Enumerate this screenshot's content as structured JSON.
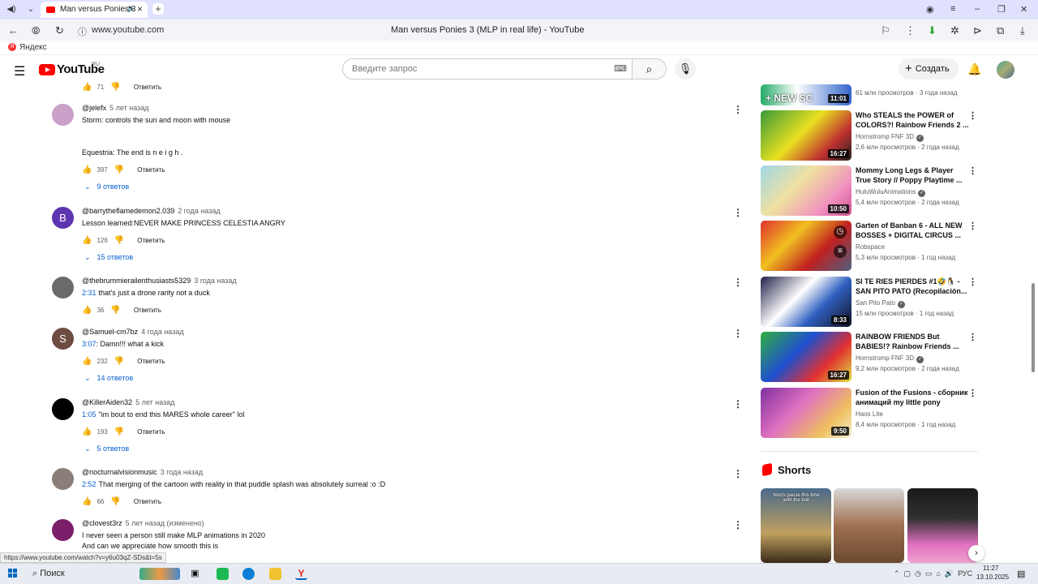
{
  "browser": {
    "tab_title": "Man versus Ponies 3",
    "url": "www.youtube.com",
    "page_title": "Man versus Ponies 3 (MLP in real life) - YouTube",
    "bookmark": "Яндекс",
    "status_url": "https://www.youtube.com/watch?v=y6u03qZ-SDs&t=5s"
  },
  "header": {
    "logo": "YouTube",
    "region": "RU",
    "search_placeholder": "Введите запрос",
    "create_label": "Создать"
  },
  "top_partial": {
    "likes": "71",
    "reply": "Ответить"
  },
  "comments": [
    {
      "author": "@jelefx",
      "time": "5 лет назад",
      "line1": "Storm: controls the sun and moon with mouse",
      "line2": "Equestria: The end is n e i g h .",
      "likes": "397",
      "reply": "Ответить",
      "replies": "9 ответов"
    },
    {
      "author": "@barrytheflamedemon2.039",
      "time": "2 года назад",
      "initial": "B",
      "text": "Lesson learned:NEVER MAKE PRINCESS CELESTIA ANGRY",
      "likes": "126",
      "reply": "Ответить",
      "replies": "15 ответов"
    },
    {
      "author": "@thebrummierailenthusiasts5329",
      "time": "3 года назад",
      "ts": "2:31",
      "text": "that's just a drone rarity not a duck",
      "likes": "36",
      "reply": "Ответить"
    },
    {
      "author": "@Samuel-cm7bz",
      "time": "4 года назад",
      "initial": "S",
      "ts": "3:07",
      "text": ": Damn!!! what a kick",
      "likes": "232",
      "reply": "Ответить",
      "replies": "14 ответов"
    },
    {
      "author": "@KillerAiden32",
      "time": "5 лет назад",
      "ts": "1:05",
      "text": "\"im bout to end this MARES whole career\" lol",
      "likes": "193",
      "reply": "Ответить",
      "replies": "5 ответов"
    },
    {
      "author": "@nocturnalvisionmusic",
      "time": "3 года назад",
      "ts": "2:52",
      "text": "That merging of the cartoon with reality in that puddle splash was absolutely surreal :o :D",
      "likes": "66",
      "reply": "Ответить"
    },
    {
      "author": "@clovest3rz",
      "time": "5 лет назад (изменено)",
      "line1": "I never seen a person still make MLP animations in 2020",
      "line2": "And can we appreciate how smooth this is"
    }
  ],
  "sidebar": {
    "partial": {
      "duration": "11:01",
      "thumb_text": "+ NEW SC",
      "meta": "61 млн просмотров · 3 года назад"
    },
    "videos": [
      {
        "title": "Who STEALS the POWER of COLORS?! Rainbow Friends 2 ...",
        "channel": "Hornstromp FNF 3D",
        "meta": "2,6 млн просмотров · 2 года назад",
        "duration": "16:27"
      },
      {
        "title": "Mommy Long Legs & Player True Story // Poppy Playtime ...",
        "channel": "HuluWuluAnimations",
        "meta": "5,4 млн просмотров · 2 года назад",
        "duration": "10:50"
      },
      {
        "title": "Garten of Banban 6 - ALL NEW BOSSES + DIGITAL CIRCUS ...",
        "channel": "Robspace",
        "meta": "5,3 млн просмотров · 1 год назад",
        "duration": ""
      },
      {
        "title": "SI TE RIES PIERDES #1🤣🐧 - SAN PITO PATO (Recopilación...",
        "channel": "San Pito Pato",
        "meta": "15 млн просмотров · 1 год назад",
        "duration": "8:33"
      },
      {
        "title": "RAINBOW FRIENDS But BABIES!? Rainbow Friends ...",
        "channel": "Hornstromp FNF 3D",
        "meta": "9,2 млн просмотров · 2 года назад",
        "duration": "16:27"
      },
      {
        "title": "Fusion of the Fusions - сборник анимаций my little pony",
        "channel": "Haos Lite",
        "meta": "8,4 млн просмотров · 1 год назад",
        "duration": "9:50"
      }
    ],
    "shorts_label": "Shorts",
    "short1_text": "Nocts pause this time with the bolt"
  },
  "taskbar": {
    "search": "Поиск",
    "lang": "РУС",
    "time": "11:27",
    "date": "13.10.2025"
  },
  "colors": {
    "accent": "#065fd4",
    "brand": "#ff0000",
    "tabbar": "#dfe1ff"
  }
}
